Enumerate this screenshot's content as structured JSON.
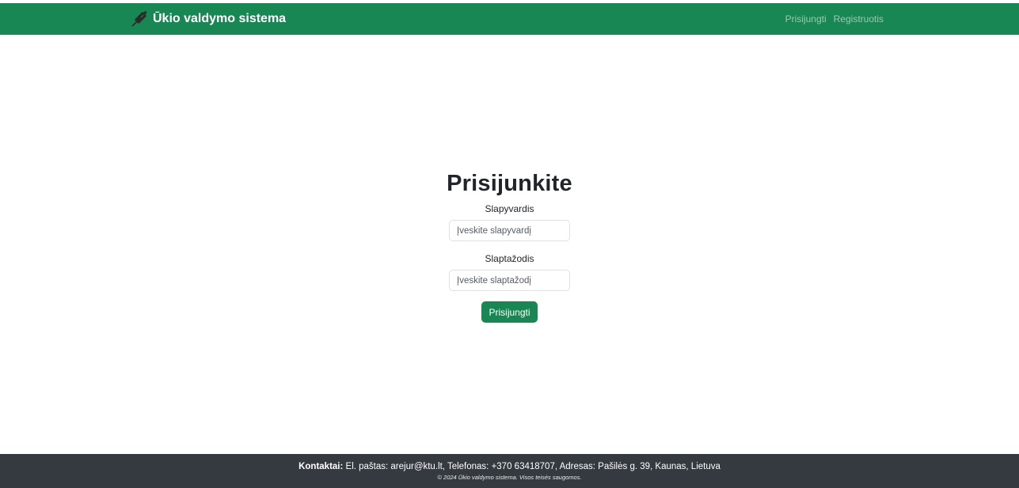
{
  "navbar": {
    "brand_icon": "wheat-icon",
    "brand_title": "Ūkio valdymo sistema",
    "links": [
      {
        "label": "Prisijungti"
      },
      {
        "label": "Registruotis"
      }
    ],
    "color": "#198754"
  },
  "login": {
    "title": "Prisijunkite",
    "username_label": "Slapyvardis",
    "username_placeholder": "Įveskite slapyvardį",
    "password_label": "Slaptažodis",
    "password_placeholder": "Įveskite slaptažodį",
    "submit_label": "Prisijungti"
  },
  "footer": {
    "contacts_label": "Kontaktai:",
    "contacts_text": " El. paštas: arejur@ktu.lt, Telefonas: +370 63418707, Adresas: Pašilės g. 39, Kaunas, Lietuva",
    "copyright": "© 2024 Ūkio valdymo sistema. Visos teisės saugomos.",
    "color": "#343a40"
  }
}
